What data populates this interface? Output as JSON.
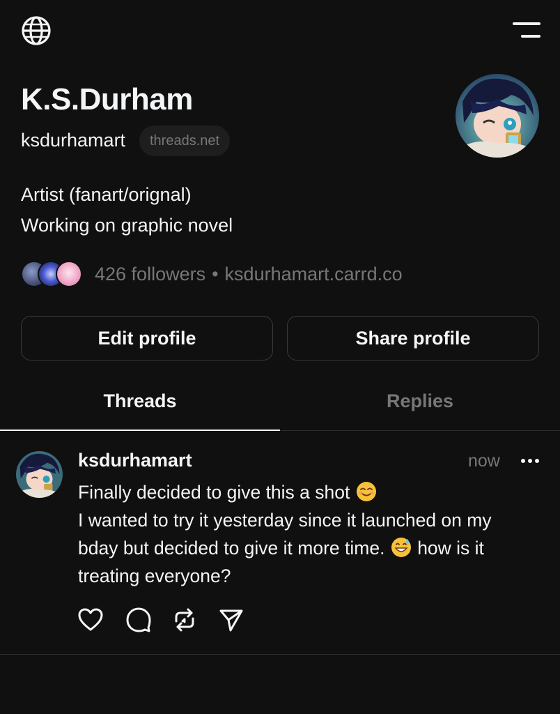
{
  "topbar": {
    "globe_icon": "globe-icon",
    "menu_icon": "menu-lines-icon"
  },
  "profile": {
    "display_name": "K.S.Durham",
    "username": "ksdurhamart",
    "domain": "threads.net",
    "bio_lines": [
      "Artist (fanart/orignal)",
      "Working on graphic novel"
    ],
    "followers": "426 followers",
    "separator": "•",
    "link": "ksdurhamart.carrd.co"
  },
  "buttons": {
    "edit": "Edit profile",
    "share": "Share profile"
  },
  "tabs": [
    {
      "label": "Threads",
      "active": true
    },
    {
      "label": "Replies",
      "active": false
    }
  ],
  "post": {
    "username": "ksdurhamart",
    "time": "now",
    "line1": "Finally decided to give this a shot",
    "line2": "I wanted to try it yesterday since it launched on my",
    "line3": "bday but decided to give it more time.",
    "line3_after": "how is it",
    "line4": "treating everyone?",
    "emojis": [
      "smiling-face-emoji",
      "grinning-sweat-emoji"
    ],
    "actions": [
      "heart-icon",
      "comment-icon",
      "repost-icon",
      "send-icon"
    ]
  },
  "colors": {
    "background": "#101010",
    "text": "#f3f5f7",
    "muted": "#777777",
    "border": "#3a3a3a"
  }
}
